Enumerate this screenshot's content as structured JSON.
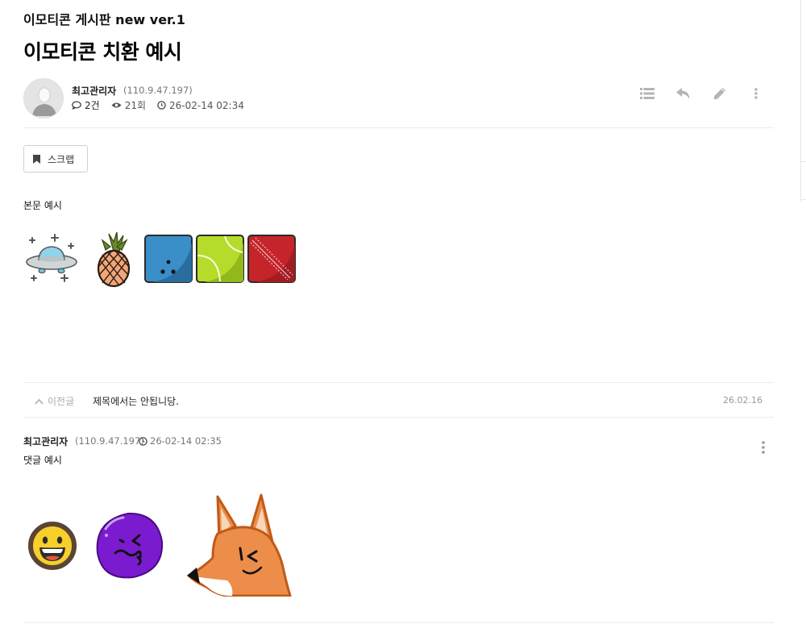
{
  "board": {
    "title": "이모티콘 게시판 new ver.1"
  },
  "post": {
    "title": "이모티콘 치환 예시",
    "author": "최고관리자",
    "ip": "(110.9.47.197)",
    "comment_count": "2건",
    "views": "21회",
    "datetime": "26-02-14 02:34",
    "scrap_label": "스크랩",
    "body_text": "본문 예시",
    "emoticons": [
      "ufo-emoticon",
      "pineapple-emoticon",
      "blue-dice-emoticon",
      "tennis-ball-emoticon",
      "red-baseball-emoticon"
    ]
  },
  "toolbar": {
    "icons": [
      "list-icon",
      "reply-icon",
      "edit-icon",
      "more-vertical-icon"
    ]
  },
  "prev_post": {
    "label": "이전글",
    "subject": "제목에서는 안됩니당.",
    "date": "26.02.16"
  },
  "comment": {
    "author": "최고관리자",
    "ip": "(110.9.47.197)",
    "datetime": "26-02-14 02:35",
    "text": "댓글 예시",
    "emoticons": [
      "laughing-face-emoticon",
      "purple-blob-emoticon",
      "fox-emoticon"
    ]
  },
  "colors": {
    "accent_text": "#000000",
    "muted_text": "#777777",
    "divider": "#ececec",
    "icon_gray": "#b5b5b5"
  }
}
